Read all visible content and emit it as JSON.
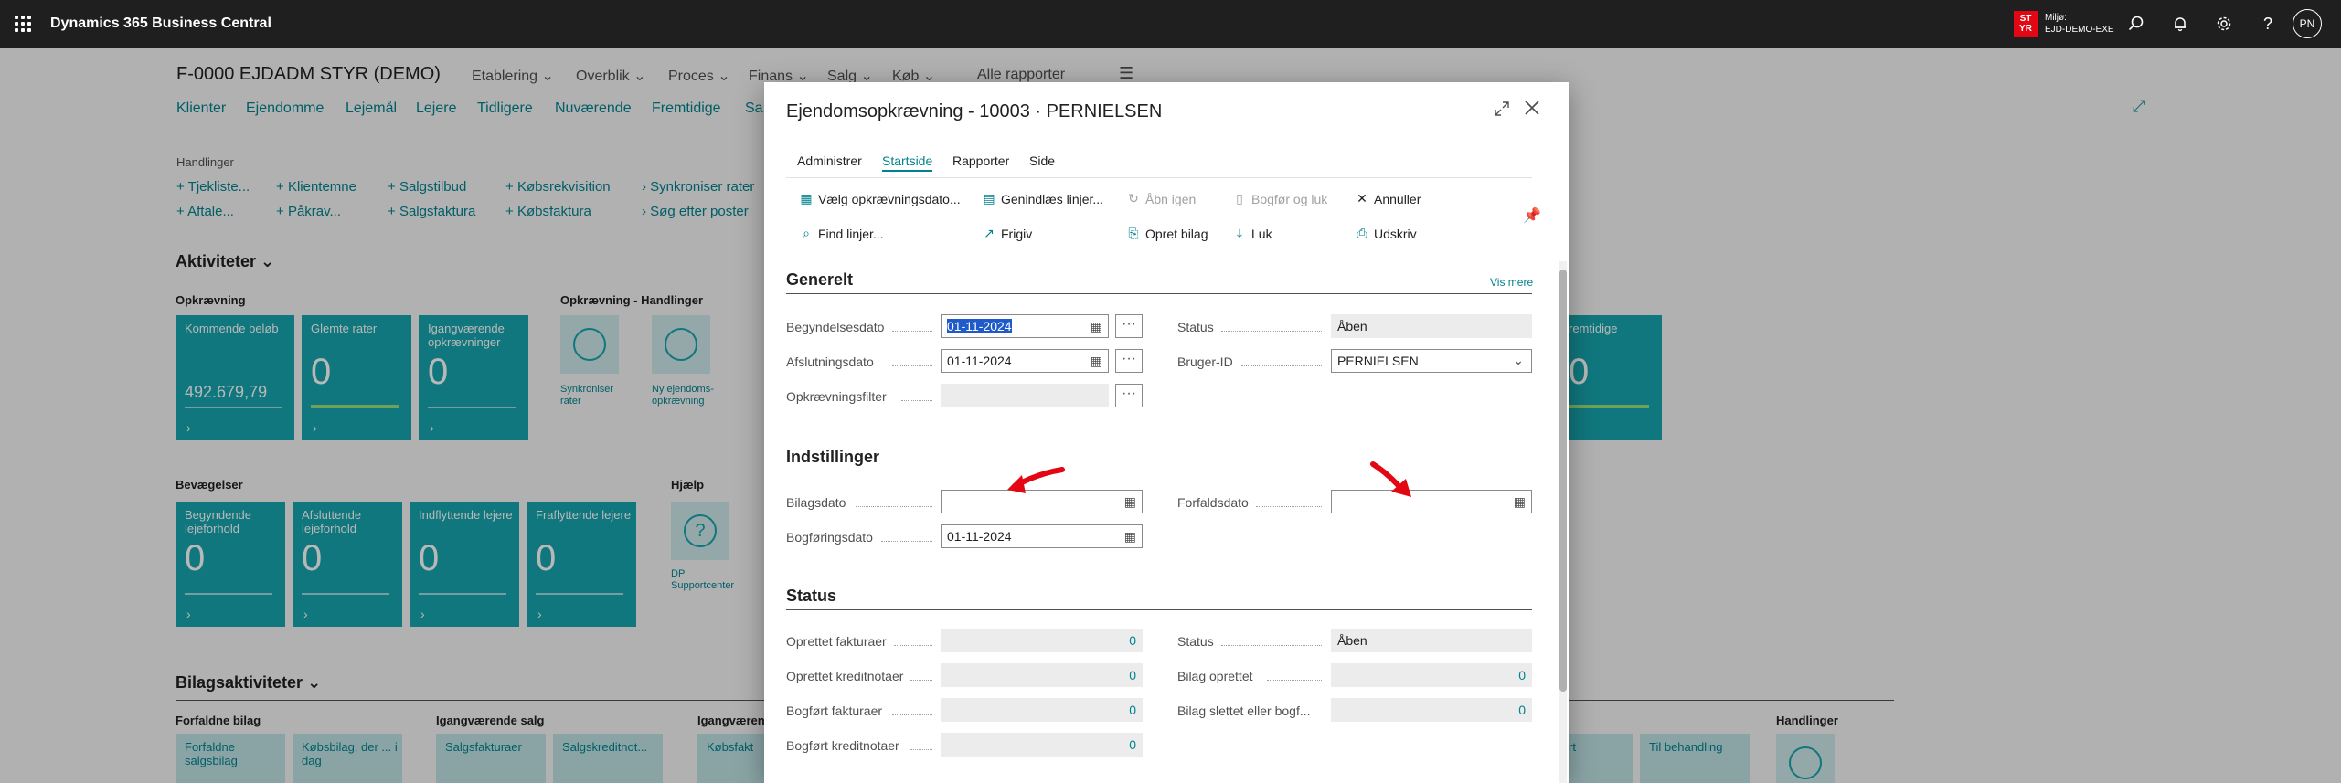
{
  "topbar": {
    "app_title": "Dynamics 365 Business Central",
    "env_badge_line1": "ST",
    "env_badge_line2": "YR",
    "env_label": "Miljø:",
    "env_name": "EJD-DEMO-EXE",
    "avatar_initials": "PN"
  },
  "page": {
    "company": "F-0000 EJDADM STYR (DEMO)",
    "menus": [
      "Etablering",
      "Overblik",
      "Proces",
      "Finans",
      "Salg",
      "Køb",
      "Alle rapporter"
    ],
    "nav": [
      "Klienter",
      "Ejendomme",
      "Lejemål",
      "Lejere",
      "Tidligere",
      "Nuværende",
      "Fremtidige",
      "Sa"
    ],
    "actions_label": "Handlinger",
    "actions_row1": [
      "Tjekliste...",
      "Klientemne",
      "Salgstilbud",
      "Købsrekvisition",
      "Synkroniser rater"
    ],
    "actions_row2": [
      "Aftale...",
      "Påkrav...",
      "Salgsfaktura",
      "Købsfaktura",
      "Søg efter poster"
    ],
    "aktiviteter": "Aktiviteter",
    "opkraevning": "Opkrævning",
    "tiles_opkraevning": [
      {
        "label": "Kommende beløb",
        "value": "492.679,79"
      },
      {
        "label": "Glemte rater",
        "value": "0"
      },
      {
        "label": "Igangværende opkrævninger",
        "value": "0"
      }
    ],
    "opk_handlinger": "Opkrævning - Handlinger",
    "opk_links": [
      "Synkroniser rater",
      "Ny ejendoms-opkrævning"
    ],
    "right_tile_label": "remtidige",
    "right_tile_value": "0",
    "bevaegelser": "Bevægelser",
    "tiles_bevaegelser": [
      {
        "label": "Begyndende lejeforhold",
        "value": "0"
      },
      {
        "label": "Afsluttende lejeforhold",
        "value": "0"
      },
      {
        "label": "Indflyttende lejere",
        "value": "0"
      },
      {
        "label": "Fraflyttende lejere",
        "value": "0"
      }
    ],
    "hjaelp": "Hjælp",
    "hjaelp_link": "DP Supportcenter",
    "bilagsaktiviteter": "Bilagsaktiviteter",
    "forfaldne_bilag": "Forfaldne bilag",
    "igangvaerende_salg": "Igangværende salg",
    "igangvaerende_koeb": "Igangværende k",
    "handlinger_right": "Handlinger",
    "bottom_tiles": [
      "Forfaldne salgsbilag",
      "Købsbilag, der ... i dag",
      "Salgsfakturaer",
      "Salgskreditnot...",
      "Købsfakt",
      "rt",
      "Til behandling"
    ]
  },
  "dialog": {
    "title": "Ejendomsopkrævning - 10003 · PERNIELSEN",
    "tabs": [
      "Administrer",
      "Startside",
      "Rapporter",
      "Side"
    ],
    "active_tab": "Startside",
    "actions": {
      "vaelg": "Vælg opkrævningsdato...",
      "genindlaes": "Genindlæs linjer...",
      "aabn_igen": "Åbn igen",
      "bogfoer_luk": "Bogfør og luk",
      "annuller": "Annuller",
      "find_linjer": "Find linjer...",
      "frigiv": "Frigiv",
      "opret_bilag": "Opret bilag",
      "luk": "Luk",
      "udskriv": "Udskriv"
    },
    "generelt": {
      "title": "Generelt",
      "vis_mere": "Vis mere",
      "begyndelsesdato_label": "Begyndelsesdato",
      "begyndelsesdato": "01-11-2024",
      "afslutningsdato_label": "Afslutningsdato",
      "afslutningsdato": "01-11-2024",
      "opkfilter_label": "Opkrævningsfilter",
      "opkfilter": "",
      "status_label": "Status",
      "status": "Åben",
      "bruger_label": "Bruger-ID",
      "bruger": "PERNIELSEN"
    },
    "indstillinger": {
      "title": "Indstillinger",
      "bilagsdato_label": "Bilagsdato",
      "bilagsdato": "",
      "bogfoeringsdato_label": "Bogføringsdato",
      "bogfoeringsdato": "01-11-2024",
      "forfaldsdato_label": "Forfaldsdato",
      "forfaldsdato": ""
    },
    "status": {
      "title": "Status",
      "oprettet_fakturaer_label": "Oprettet fakturaer",
      "oprettet_fakturaer": "0",
      "oprettet_kreditnotaer_label": "Oprettet kreditnotaer",
      "oprettet_kreditnotaer": "0",
      "bogfoert_fakturaer_label": "Bogført fakturaer",
      "bogfoert_fakturaer": "0",
      "bogfoert_kreditnotaer_label": "Bogført kreditnotaer",
      "bogfoert_kreditnotaer": "0",
      "status_label": "Status",
      "status": "Åben",
      "bilag_oprettet_label": "Bilag oprettet",
      "bilag_oprettet": "0",
      "bilag_slettet_label": "Bilag slettet eller bogf...",
      "bilag_slettet": "0"
    }
  },
  "colors": {
    "accent": "#00838f",
    "tile": "#16a5ad",
    "annotation_arrow": "#e30613"
  }
}
